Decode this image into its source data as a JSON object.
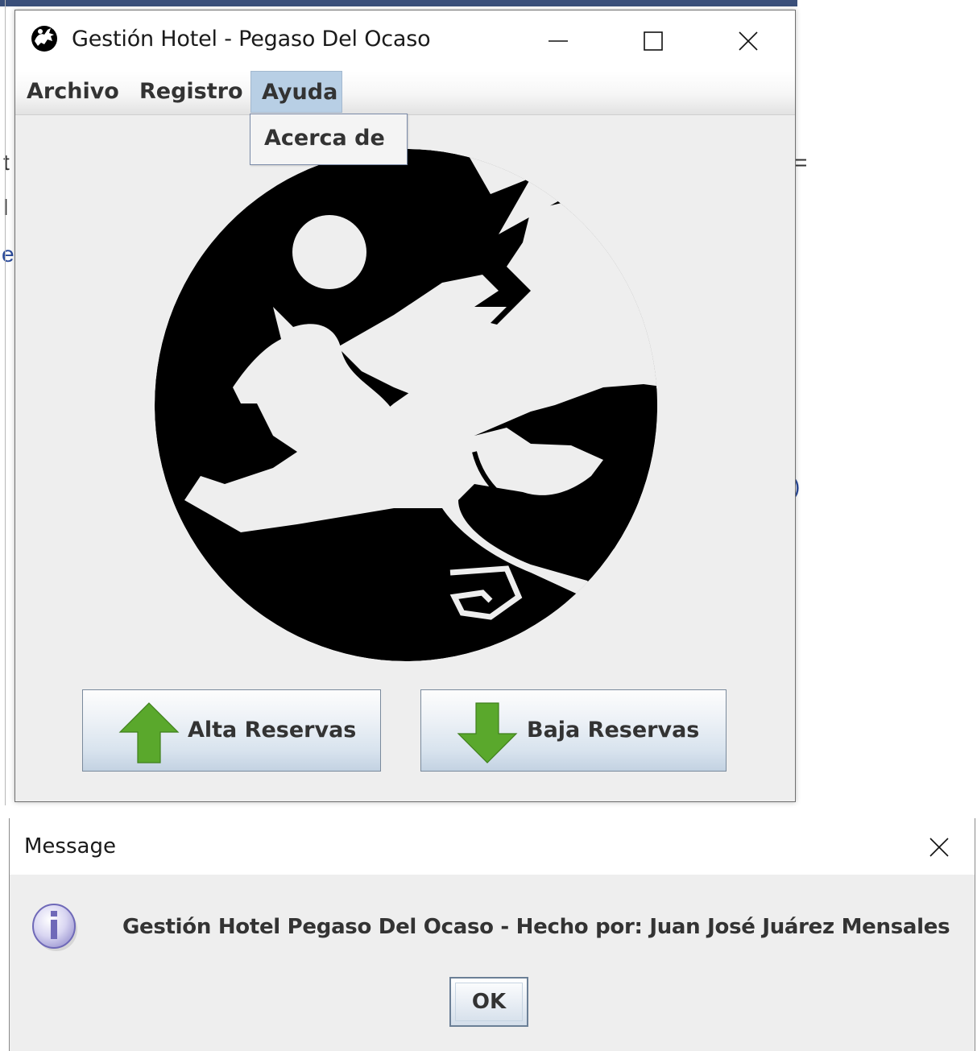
{
  "main_window": {
    "title": "Gestión Hotel - Pegaso Del Ocaso",
    "icon": "pegasus-logo-icon",
    "controls": [
      "minimize-icon",
      "maximize-icon",
      "close-icon"
    ]
  },
  "menubar": {
    "items": [
      {
        "label": "Archivo"
      },
      {
        "label": "Registro"
      },
      {
        "label": "Ayuda",
        "active": true
      }
    ],
    "open_menu": {
      "parent": "Ayuda",
      "items": [
        {
          "label": "Acerca de"
        }
      ]
    }
  },
  "logo": {
    "icon": "pegasus-logo",
    "colors": {
      "fill": "#000000",
      "background": "#eeeeee"
    }
  },
  "buttons": {
    "alta": {
      "label": "Alta Reservas",
      "icon": "arrow-up-icon"
    },
    "baja": {
      "label": "Baja Reservas",
      "icon": "arrow-down-icon"
    }
  },
  "dialog": {
    "title": "Message",
    "message": "Gestión Hotel Pegaso Del Ocaso - Hecho por: Juan José Juárez Mensales",
    "icon": "info-icon",
    "ok_label": "OK"
  },
  "colors": {
    "window_background": "#eeeeee",
    "menu_highlight": "#b8cfe5",
    "arrow_green": "#5aa82c",
    "text": "#333333"
  }
}
